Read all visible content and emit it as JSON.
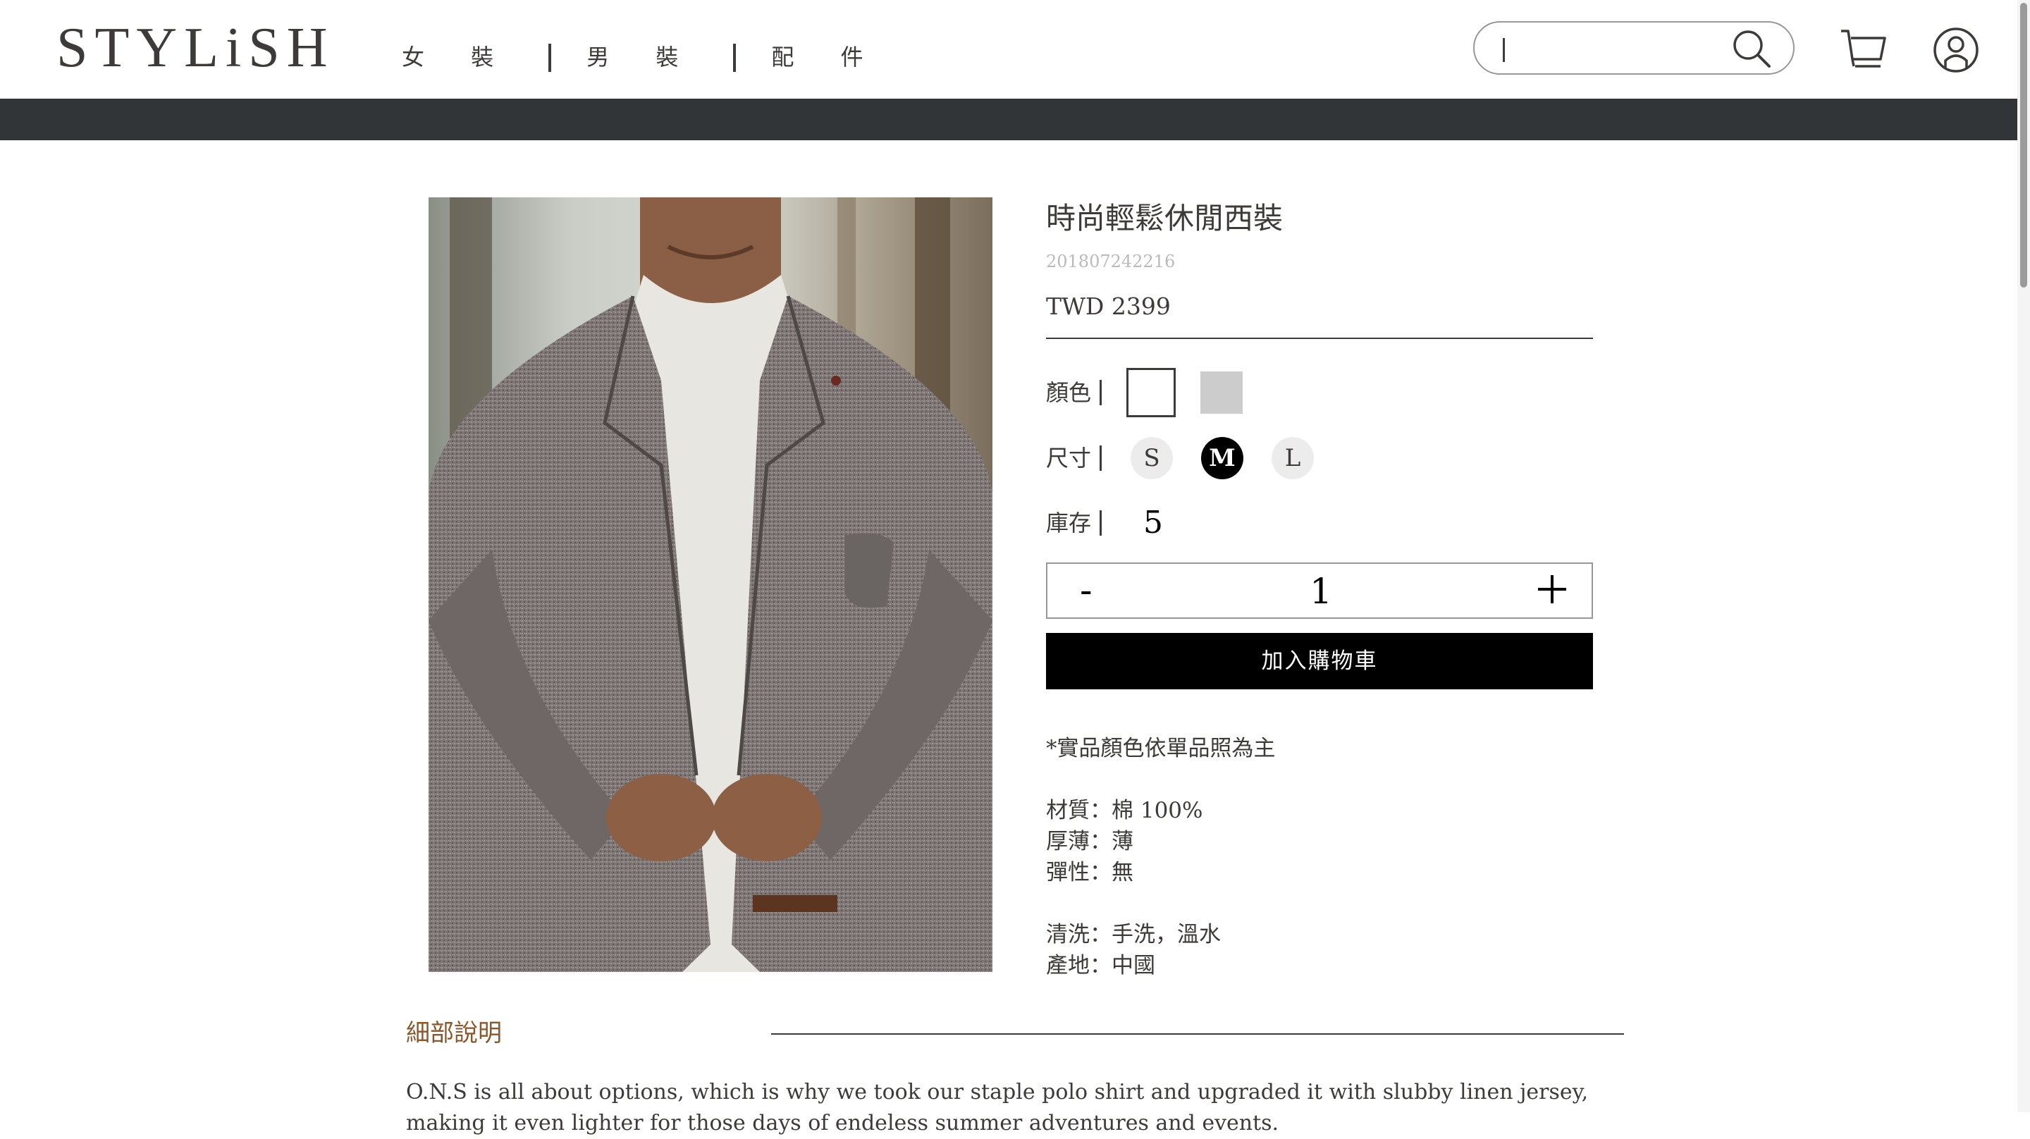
{
  "header": {
    "logo_text": "STYLiSH",
    "nav": [
      {
        "label": "女 裝"
      },
      {
        "label": "男 裝"
      },
      {
        "label": "配 件"
      }
    ],
    "search": {
      "value": "",
      "placeholder": ""
    },
    "icons": [
      "search-icon",
      "cart-icon",
      "member-icon"
    ]
  },
  "product": {
    "image": "model-wearing-grey-tweed-blazer-over-white-turtleneck",
    "title": "時尚輕鬆休閒西裝",
    "id": "201807242216",
    "price": "TWD 2399",
    "color_label": "顏色",
    "colors": [
      {
        "hex": "#FFFFFF",
        "selected": true
      },
      {
        "hex": "#CCCCCC",
        "selected": false
      }
    ],
    "size_label": "尺寸",
    "sizes": [
      {
        "label": "S",
        "selected": false
      },
      {
        "label": "M",
        "selected": true
      },
      {
        "label": "L",
        "selected": false
      }
    ],
    "stock_label": "庫存",
    "stock": "5",
    "quantity": {
      "minus": "-",
      "value": "1",
      "plus": "+"
    },
    "add_to_cart": "加入購物車",
    "note": "*實品顏色依單品照為主",
    "texture": "材質：棉 100%",
    "thickness": "厚薄：薄",
    "elasticity": "彈性：無",
    "wash": "清洗：手洗，溫水",
    "place": "產地：中國"
  },
  "details": {
    "title": "細部說明",
    "text": "O.N.S is all about options, which is why we took our staple polo shirt and upgraded it with slubby linen jersey, making it even lighter for those days of endeless summer adventures and events."
  },
  "colors": {
    "text": "#3f3a3a",
    "dark_bar": "#313538",
    "details_title": "#8b572a",
    "button_bg": "#000000",
    "muted": "#bababa"
  }
}
